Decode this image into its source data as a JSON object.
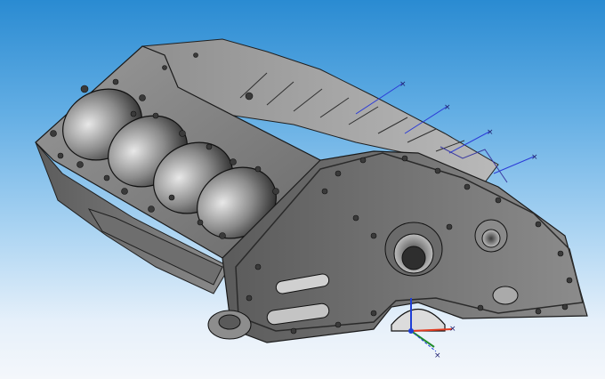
{
  "viewport": {
    "model": "engine-block-v8",
    "view": "isometric-shaded-with-edges",
    "background_top": "#2a8bd2",
    "background_bottom": "#f4f7fb",
    "model_color": "#7d7d7d",
    "edge_color": "#202020"
  },
  "triad": {
    "x_color": "#e23a1f",
    "y_color": "#1f8a2b",
    "z_color": "#1f3fd6",
    "origin_color": "#1f3fd6"
  },
  "reference_axes": {
    "count": 4,
    "marker": "x",
    "color": "#2b3bd8"
  }
}
